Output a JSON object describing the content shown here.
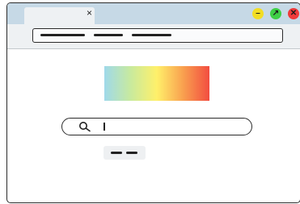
{
  "browser": {
    "tab": {
      "close_glyph": "×"
    },
    "controls": {
      "minimize_glyph": "–",
      "maximize_glyph": "↗",
      "close_glyph": "✕"
    },
    "address_bar": {
      "placeholder_segments": 3
    }
  },
  "search_page": {
    "logo": {
      "gradient": [
        "#9fd9ea",
        "#c8ea9e",
        "#fff06a",
        "#f9a04f",
        "#f24d40"
      ]
    },
    "search_input": {
      "icon": "search-icon"
    },
    "search_button": {
      "placeholder_segments": 2
    }
  }
}
